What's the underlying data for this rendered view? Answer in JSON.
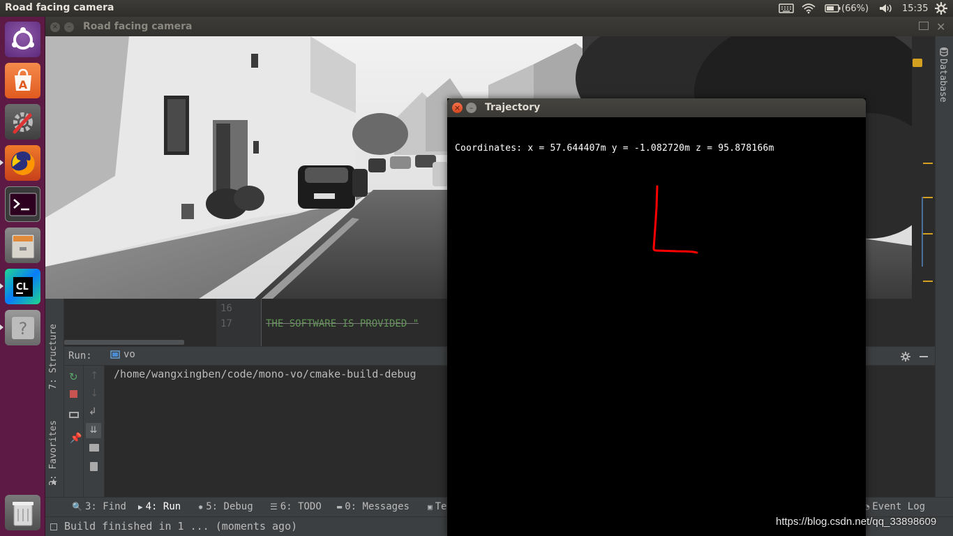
{
  "top_panel": {
    "title": "Road facing camera",
    "battery": "(66%)",
    "clock": "15:35"
  },
  "launcher": {
    "items": [
      "ubuntu-dash",
      "software-center",
      "system-settings",
      "firefox",
      "terminal",
      "files",
      "clion",
      "help",
      "trash"
    ]
  },
  "camera_window": {
    "title": "Road facing camera"
  },
  "editor": {
    "line_numbers": [
      "16",
      "17"
    ],
    "line_text": "THE SOFTWARE IS PROVIDED \""
  },
  "run_panel": {
    "label": "Run:",
    "config_name": "vo",
    "output": "/home/wangxingben/code/mono-vo/cmake-build-debug"
  },
  "side_tools": {
    "structure": "7: Structure",
    "favorites": "2: Favorites",
    "database": "Database"
  },
  "bottom_tabs": {
    "find": "3: Find",
    "run": "4: Run",
    "debug": "5: Debug",
    "todo": "6: TODO",
    "messages": "0: Messages",
    "terminal_partial": "Te",
    "event_log": "Event Log"
  },
  "status": {
    "message": "Build finished in 1 ... (moments ago)"
  },
  "trajectory_window": {
    "title": "Trajectory",
    "coordinates": "Coordinates: x = 57.644407m y = -1.082720m z = 95.878166m",
    "path_color": "#ff0000"
  },
  "watermark": "https://blog.csdn.net/qq_33898609"
}
